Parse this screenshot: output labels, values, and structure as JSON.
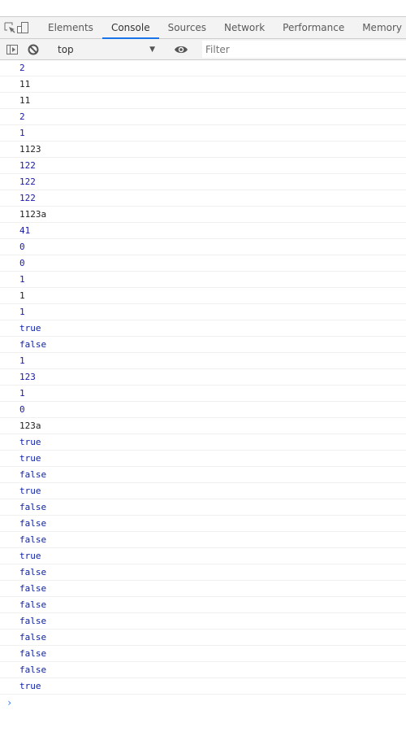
{
  "tabs": [
    {
      "label": "Elements",
      "active": false
    },
    {
      "label": "Console",
      "active": true
    },
    {
      "label": "Sources",
      "active": false
    },
    {
      "label": "Network",
      "active": false
    },
    {
      "label": "Performance",
      "active": false
    },
    {
      "label": "Memory",
      "active": false
    }
  ],
  "toolbar": {
    "context": "top",
    "filter_placeholder": "Filter"
  },
  "colors": {
    "accent": "#1a73e8",
    "number": "#1a1aa6",
    "string": "#222222",
    "boolean": "#0d22aa",
    "prompt": "#367cf1"
  },
  "console": {
    "messages": [
      {
        "text": "2",
        "type": "number"
      },
      {
        "text": "11",
        "type": "string"
      },
      {
        "text": "11",
        "type": "string"
      },
      {
        "text": "2",
        "type": "number"
      },
      {
        "text": "1",
        "type": "number"
      },
      {
        "text": "1123",
        "type": "string"
      },
      {
        "text": "122",
        "type": "number"
      },
      {
        "text": "122",
        "type": "number"
      },
      {
        "text": "122",
        "type": "number"
      },
      {
        "text": "1123a",
        "type": "string"
      },
      {
        "text": "41",
        "type": "number"
      },
      {
        "text": "0",
        "type": "number"
      },
      {
        "text": "0",
        "type": "number"
      },
      {
        "text": "1",
        "type": "number"
      },
      {
        "text": "1",
        "type": "string"
      },
      {
        "text": "1",
        "type": "number"
      },
      {
        "text": "true",
        "type": "boolean"
      },
      {
        "text": "false",
        "type": "boolean"
      },
      {
        "text": "1",
        "type": "number"
      },
      {
        "text": "123",
        "type": "number"
      },
      {
        "text": "1",
        "type": "number"
      },
      {
        "text": "0",
        "type": "number"
      },
      {
        "text": "123a",
        "type": "string"
      },
      {
        "text": "true",
        "type": "boolean"
      },
      {
        "text": "true",
        "type": "boolean"
      },
      {
        "text": "false",
        "type": "boolean"
      },
      {
        "text": "true",
        "type": "boolean"
      },
      {
        "text": "false",
        "type": "boolean"
      },
      {
        "text": "false",
        "type": "boolean"
      },
      {
        "text": "false",
        "type": "boolean"
      },
      {
        "text": "true",
        "type": "boolean"
      },
      {
        "text": "false",
        "type": "boolean"
      },
      {
        "text": "false",
        "type": "boolean"
      },
      {
        "text": "false",
        "type": "boolean"
      },
      {
        "text": "false",
        "type": "boolean"
      },
      {
        "text": "false",
        "type": "boolean"
      },
      {
        "text": "false",
        "type": "boolean"
      },
      {
        "text": "false",
        "type": "boolean"
      },
      {
        "text": "true",
        "type": "boolean"
      }
    ],
    "prompt_symbol": "›"
  }
}
